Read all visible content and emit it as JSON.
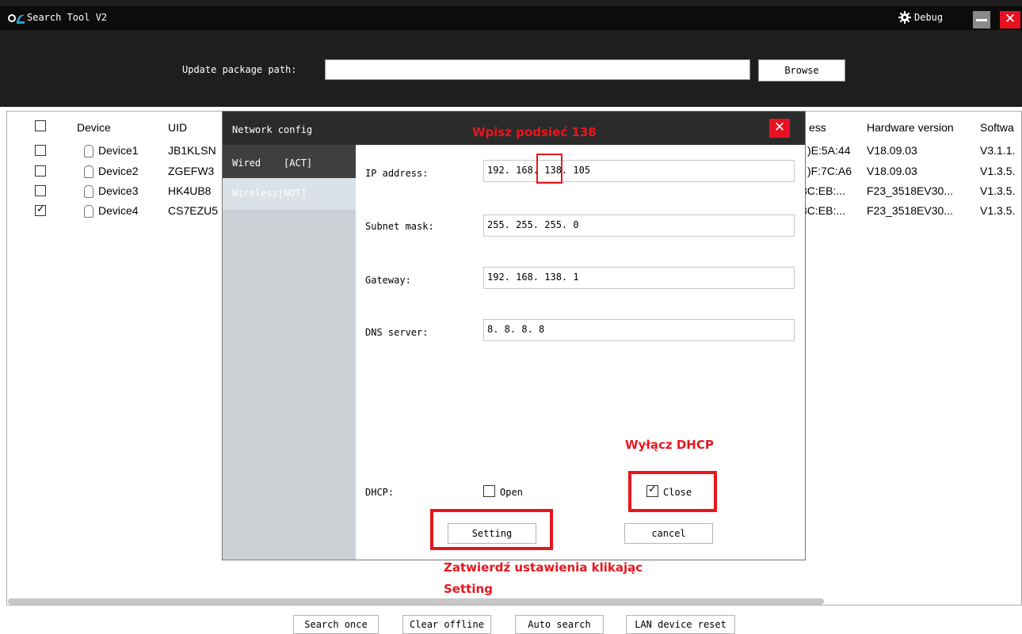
{
  "window": {
    "title": "Search Tool V2",
    "debug_label": "Debug",
    "close_glyph": "✕"
  },
  "update": {
    "label": "Update package path:",
    "value": "",
    "browse_label": "Browse"
  },
  "table": {
    "columns": {
      "device": "Device",
      "uid": "UID",
      "address": "ess",
      "hardware": "Hardware version",
      "software": "Softwa"
    },
    "rows": [
      {
        "checked": false,
        "device": "Device1",
        "uid": "JB1KLSN",
        "address": ")E:5A:44",
        "hardware": "V18.09.03",
        "software": "V3.1.1."
      },
      {
        "checked": false,
        "device": "Device2",
        "uid": "ZGEFW3",
        "address": ")F:7C:A6",
        "hardware": "V18.09.03",
        "software": "V1.3.5."
      },
      {
        "checked": false,
        "device": "Device3",
        "uid": "HK4UB8",
        "address": "3C:EB:...",
        "hardware": "F23_3518EV30...",
        "software": "V1.3.5."
      },
      {
        "checked": true,
        "device": "Device4",
        "uid": "CS7EZU5",
        "address": "3C:EB:...",
        "hardware": "F23_3518EV30...",
        "software": "V1.3.5."
      }
    ]
  },
  "bottom_buttons": {
    "search_once": "Search once",
    "clear_offline": "Clear offline",
    "auto_search": "Auto search",
    "lan_reset": "LAN device reset"
  },
  "dialog": {
    "title": "Network config",
    "close_glyph": "✕",
    "tabs": {
      "wired": "Wired    [ACT]",
      "wireless": "Wireless[NOT]"
    },
    "fields": {
      "ip": {
        "label": "IP address:",
        "value": "192. 168. 138. 105"
      },
      "mask": {
        "label": "Subnet mask:",
        "value": "255. 255. 255. 0"
      },
      "gateway": {
        "label": "Gateway:",
        "value": "192. 168. 138. 1"
      },
      "dns": {
        "label": "DNS server:",
        "value": "8. 8. 8. 8"
      }
    },
    "dhcp": {
      "label": "DHCP:",
      "open_label": "Open",
      "close_label": "Close",
      "selected": "Close"
    },
    "setting_label": "Setting",
    "cancel_label": "cancel"
  },
  "annotations": {
    "subnet_hint": "Wpisz podsieć 138",
    "dhcp_hint": "Wyłącz DHCP",
    "confirm_line1": "Zatwierdź ustawienia klikając",
    "confirm_line2": "Setting"
  },
  "colors": {
    "annotation_red": "#e8161e",
    "title_bar": "#0c0c0c",
    "header_bg": "#1e1e1e",
    "close_red": "#e81123"
  }
}
